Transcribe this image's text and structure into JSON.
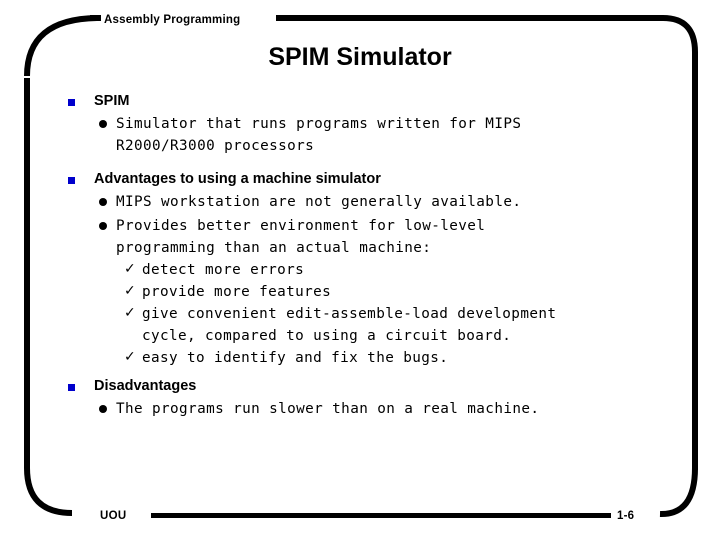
{
  "slide": {
    "header_label": "Assembly Programming",
    "title": "SPIM Simulator",
    "accent_color": "#0000cc",
    "frame_color": "#000000",
    "background_color": "#ffffff"
  },
  "bullets": {
    "square_glyph": "■",
    "dot_glyph": "●",
    "check_glyph": "✓"
  },
  "content": {
    "sections": [
      {
        "heading": "SPIM",
        "items": [
          {
            "level": 2,
            "lines": [
              "Simulator that runs programs written for MIPS",
              "R2000/R3000 processors"
            ]
          }
        ]
      },
      {
        "heading": "Advantages to using a machine simulator",
        "items": [
          {
            "level": 2,
            "lines": [
              "MIPS workstation are not generally available."
            ]
          },
          {
            "level": 2,
            "lines": [
              "Provides better environment for low-level",
              "programming than an actual machine:"
            ]
          },
          {
            "level": 3,
            "lines": [
              "detect more errors"
            ]
          },
          {
            "level": 3,
            "lines": [
              "provide more features"
            ]
          },
          {
            "level": 3,
            "lines": [
              "give convenient edit-assemble-load development",
              "cycle, compared to using a circuit board."
            ]
          },
          {
            "level": 3,
            "lines": [
              "easy to identify and fix the bugs."
            ]
          }
        ]
      },
      {
        "heading": "Disadvantages",
        "items": [
          {
            "level": 2,
            "lines": [
              "The programs run slower than on a real machine."
            ]
          }
        ]
      }
    ]
  },
  "footer": {
    "left_label": "UOU",
    "page_number": "1-6"
  },
  "text": {
    "s0_heading": "SPIM",
    "s0_i0_l0": "Simulator that runs programs written for MIPS",
    "s0_i0_l1": "R2000/R3000 processors",
    "s1_heading": "Advantages to using a machine simulator",
    "s1_i0_l0": "MIPS workstation are not generally available.",
    "s1_i1_l0": "Provides better environment for low-level",
    "s1_i1_l1": "programming than an actual machine:",
    "s1_i2_l0": "detect more errors",
    "s1_i3_l0": "provide more features",
    "s1_i4_l0": "give convenient edit-assemble-load development",
    "s1_i4_l1": "cycle, compared to using a circuit board.",
    "s1_i5_l0": "easy to identify and fix the bugs.",
    "s2_heading": "Disadvantages",
    "s2_i0_l0": "The programs run slower than on a real machine."
  }
}
